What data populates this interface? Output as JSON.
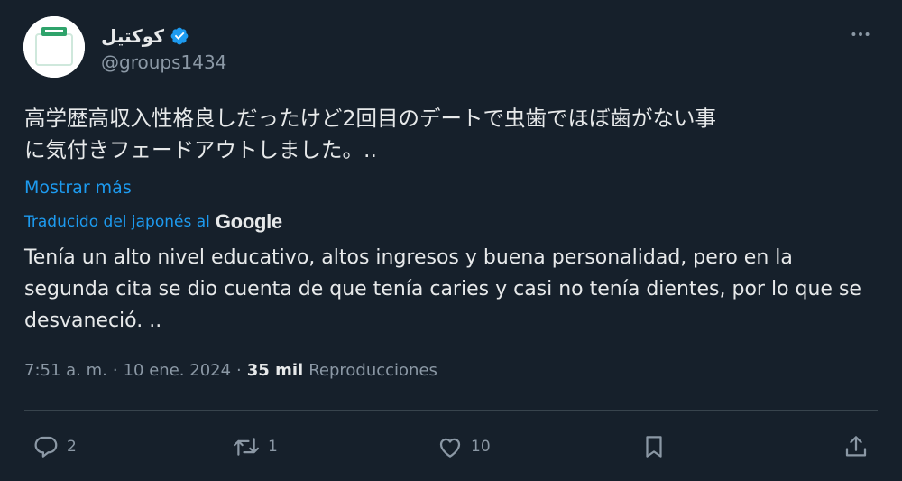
{
  "author": {
    "display_name": "کوکتیل",
    "handle": "@groups1434",
    "verified": true,
    "verified_color": "#1d9bf0"
  },
  "tweet": {
    "text": "高学歴高収入性格良しだったけど2回目のデートで虫歯でほぼ歯がない事\nに気付きフェードアウトしました。..",
    "show_more": "Mostrar más",
    "translated_by": "Traducido del japonés al",
    "translator_logo": "Google",
    "translation": "Tenía un alto nivel educativo, altos ingresos y buena personalidad, pero en la segunda cita se dio cuenta de que tenía caries y casi no tenía dientes, por lo que se desvaneció. .."
  },
  "meta": {
    "time": "7:51 a. m.",
    "separator": "·",
    "date": "10 ene. 2024",
    "separator2": "·",
    "views_count": "35 mil",
    "views_label": "Reproducciones"
  },
  "actions": {
    "replies": "2",
    "reposts": "1",
    "likes": "10"
  },
  "colors": {
    "background": "#16202b",
    "accent": "#1d9bf0",
    "text": "#e7e9ea",
    "muted": "#8b98a5",
    "divider": "#38444d"
  },
  "icons": [
    "more-icon",
    "verified-icon",
    "reply-icon",
    "repost-icon",
    "like-icon",
    "bookmark-icon",
    "share-icon"
  ]
}
